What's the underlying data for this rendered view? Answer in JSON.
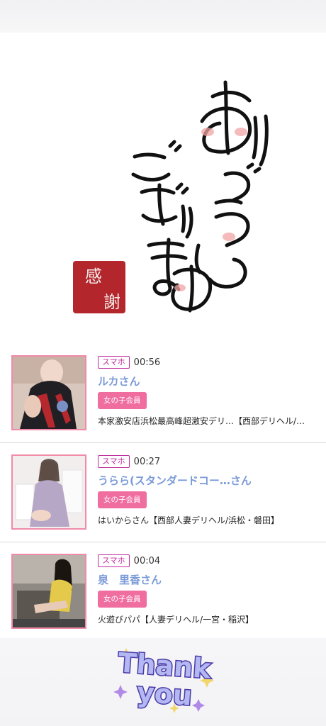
{
  "hero": {
    "calligraphy_lines": [
      "ありがとう",
      "ございます"
    ],
    "stamp_text": [
      "感",
      "謝"
    ]
  },
  "visits": [
    {
      "device": "スマホ",
      "time": "00:56",
      "name": "ルカさん",
      "member_label": "女の子会員",
      "shop": "本家激安店浜松最高峰超激安デリ…【西部デリヘル/…"
    },
    {
      "device": "スマホ",
      "time": "00:27",
      "name": "うらら(スタンダードコー…さん",
      "member_label": "女の子会員",
      "shop": "はいからさん【西部人妻デリヘル/浜松・磐田】"
    },
    {
      "device": "スマホ",
      "time": "00:04",
      "name": "泉　里香さん",
      "member_label": "女の子会員",
      "shop": "火遊びパパ【人妻デリヘル/一宮・稲沢】"
    }
  ],
  "footer": {
    "thank_you_lines": [
      "Thank",
      "you"
    ]
  },
  "colors": {
    "name_link": "#7b9bd8",
    "device_badge": "#c02c9c",
    "member_badge": "#f06da0",
    "thumb_border": "#f08aa8",
    "stamp_red": "#b3262b"
  }
}
